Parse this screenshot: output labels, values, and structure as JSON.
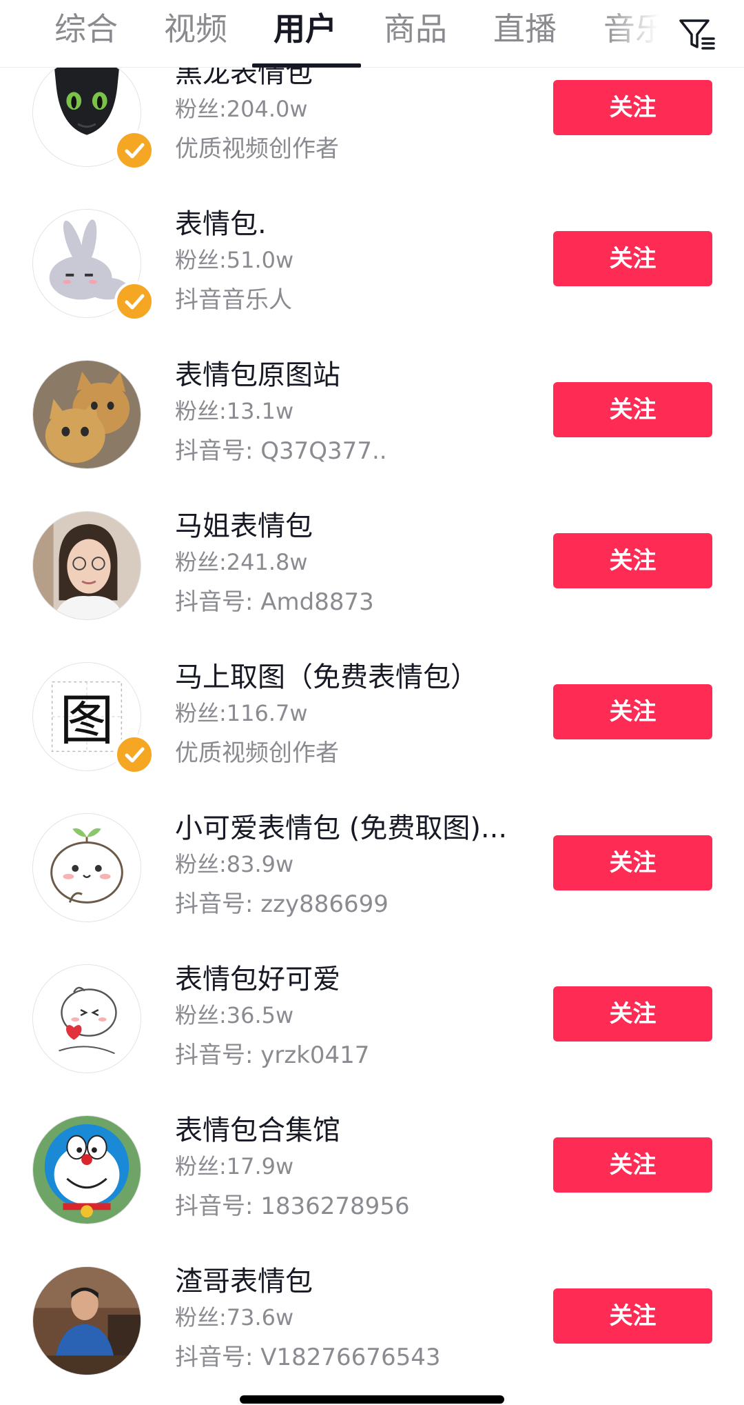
{
  "tabs": [
    {
      "label": "综合",
      "active": false
    },
    {
      "label": "视频",
      "active": false
    },
    {
      "label": "用户",
      "active": true
    },
    {
      "label": "商品",
      "active": false
    },
    {
      "label": "直播",
      "active": false
    },
    {
      "label": "音乐",
      "active": false
    }
  ],
  "filter_icon": "filter-icon",
  "follow_label": "关注",
  "accent_color": "#fe2c55",
  "badge_color": "#f5a623",
  "users": [
    {
      "name": "黑龙表情包",
      "fans": "粉丝:204.0w",
      "desc": "优质视频创作者",
      "verified": true,
      "avatar": "black-dragon-avatar"
    },
    {
      "name": "表情包.",
      "fans": "粉丝:51.0w",
      "desc": "抖音音乐人",
      "verified": true,
      "avatar": "bunny-avatar"
    },
    {
      "name": "表情包原图站",
      "fans": "粉丝:13.1w",
      "desc": "抖音号: Q37Q377..",
      "verified": false,
      "avatar": "cats-photo-avatar"
    },
    {
      "name": "马姐表情包",
      "fans": "粉丝:241.8w",
      "desc": "抖音号: Amd8873",
      "verified": false,
      "avatar": "woman-photo-avatar"
    },
    {
      "name": "马上取图（免费表情包）",
      "fans": "粉丝:116.7w",
      "desc": "优质视频创作者",
      "verified": true,
      "avatar": "tu-character-avatar",
      "avatar_text": "图"
    },
    {
      "name": "小可爱表情包 (免费取图)...",
      "fans": "粉丝:83.9w",
      "desc": "抖音号: zzy886699",
      "verified": false,
      "avatar": "sprout-bun-avatar"
    },
    {
      "name": "表情包好可爱",
      "fans": "粉丝:36.5w",
      "desc": "抖音号: yrzk0417",
      "verified": false,
      "avatar": "bun-heart-avatar"
    },
    {
      "name": "表情包合集馆",
      "fans": "粉丝:17.9w",
      "desc": "抖音号: 1836278956",
      "verified": false,
      "avatar": "doraemon-avatar"
    },
    {
      "name": "渣哥表情包",
      "fans": "粉丝:73.6w",
      "desc": "抖音号: V18276676543",
      "verified": false,
      "avatar": "man-photo-avatar"
    }
  ]
}
